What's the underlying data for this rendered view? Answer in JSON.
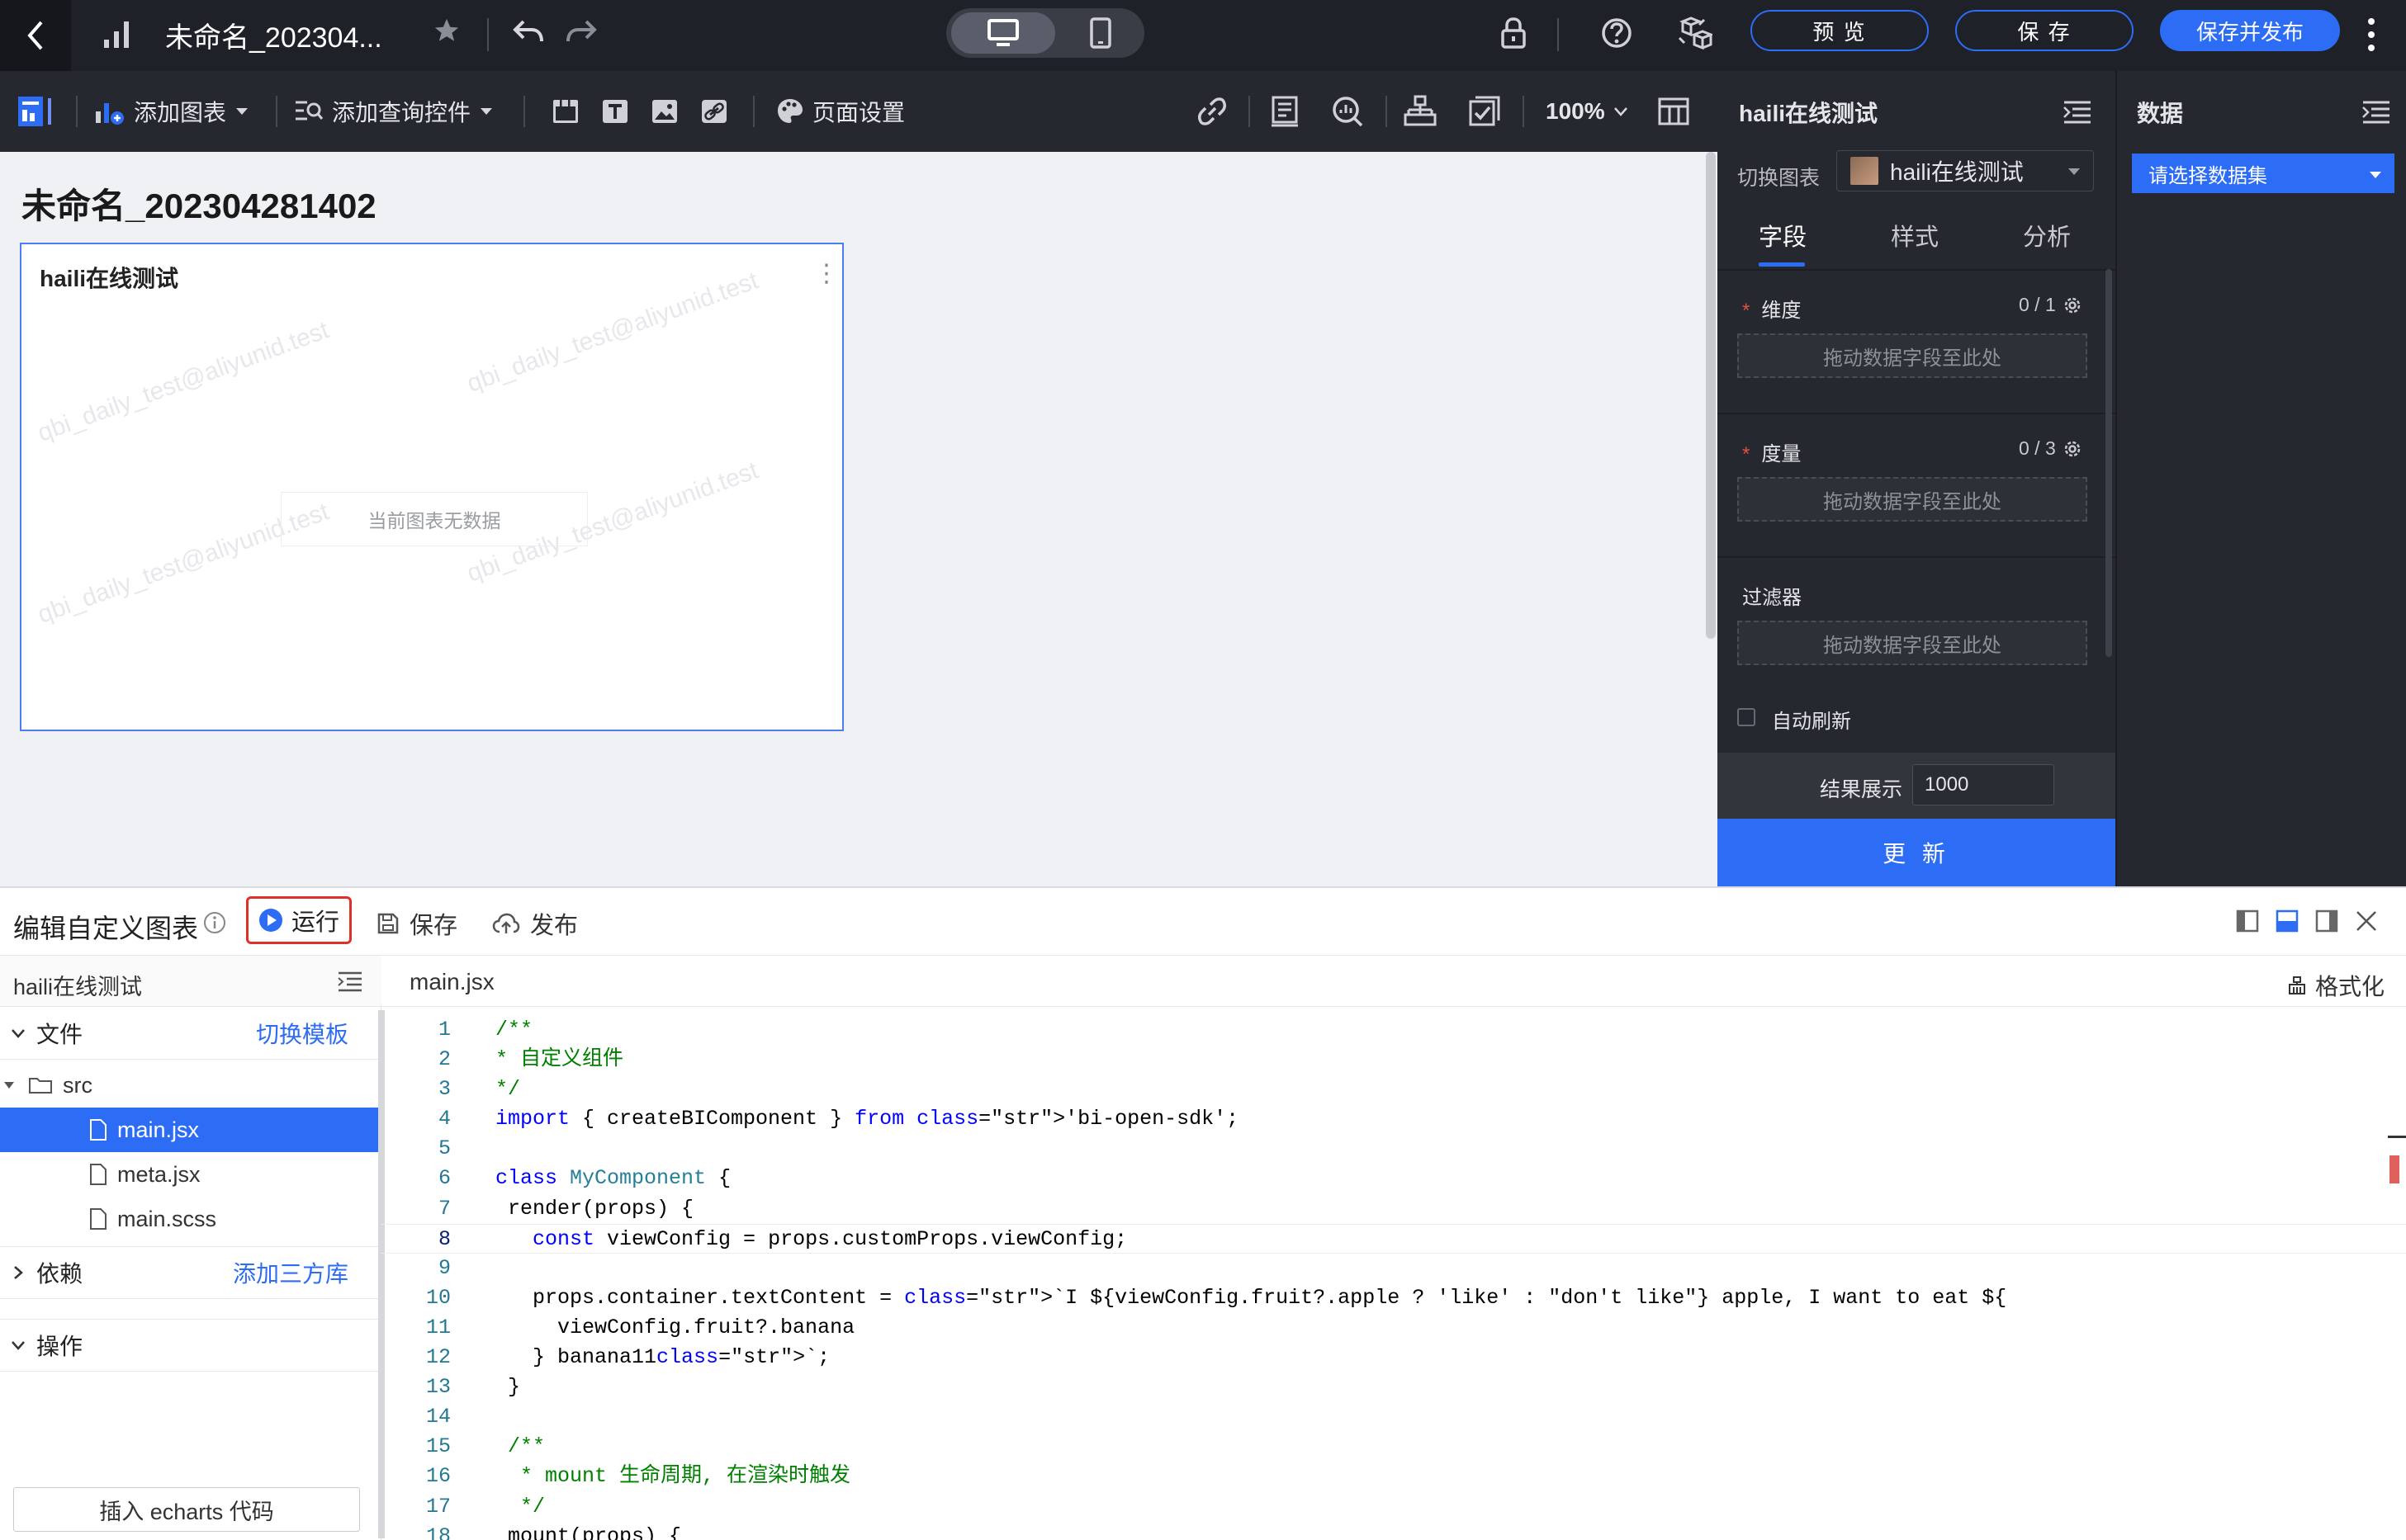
{
  "topbar": {
    "title": "未命名_202304...",
    "buttons": {
      "preview": "预 览",
      "save": "保 存",
      "publish": "保存并发布"
    }
  },
  "toolbar": {
    "add_chart": "添加图表",
    "add_query": "添加查询控件",
    "page_settings": "页面设置",
    "zoom": "100%"
  },
  "canvas": {
    "title": "未命名_202304281402",
    "card": {
      "title": "haili在线测试",
      "empty_text": "当前图表无数据",
      "watermark": "qbi_daily_test@aliyunid.test"
    }
  },
  "config_panel": {
    "title": "haili在线测试",
    "switch_label": "切换图表",
    "selected_chart": "haili在线测试",
    "tabs": [
      "字段",
      "样式",
      "分析"
    ],
    "sections": [
      {
        "label": "维度",
        "required": "*",
        "count": "0 / 1",
        "drop": "拖动数据字段至此处"
      },
      {
        "label": "度量",
        "required": "*",
        "count": "0 / 3",
        "drop": "拖动数据字段至此处"
      },
      {
        "label": "过滤器",
        "drop": "拖动数据字段至此处"
      }
    ],
    "auto_refresh": "自动刷新",
    "result_label": "结果展示",
    "result_value": "1000",
    "update": "更 新"
  },
  "data_panel": {
    "title": "数据",
    "dataset_placeholder": "请选择数据集"
  },
  "editor": {
    "title": "编辑自定义图表",
    "run": "运行",
    "save": "保存",
    "publish": "发布",
    "project_name": "haili在线测试",
    "files_section": "文件",
    "switch_template": "切换模板",
    "src_folder": "src",
    "files": [
      "main.jsx",
      "meta.jsx",
      "main.scss"
    ],
    "deps_section": "依赖",
    "add_lib": "添加三方库",
    "ops_section": "操作",
    "insert_echarts": "插入 echarts 代码",
    "active_file": "main.jsx",
    "format": "格式化"
  },
  "code": [
    "/**",
    "* 自定义组件",
    "*/",
    "import { createBIComponent } from 'bi-open-sdk';",
    "",
    "class MyComponent {",
    " render(props) {",
    "   const viewConfig = props.customProps.viewConfig;",
    "",
    "   props.container.textContent = `I ${viewConfig.fruit?.apple ? 'like' : \"don't like\"} apple, I want to eat ${",
    "     viewConfig.fruit?.banana",
    "   } banana11`;",
    " }",
    "",
    " /**",
    "  * mount 生命周期, 在渲染时触发",
    "  */",
    " mount(props) {"
  ]
}
